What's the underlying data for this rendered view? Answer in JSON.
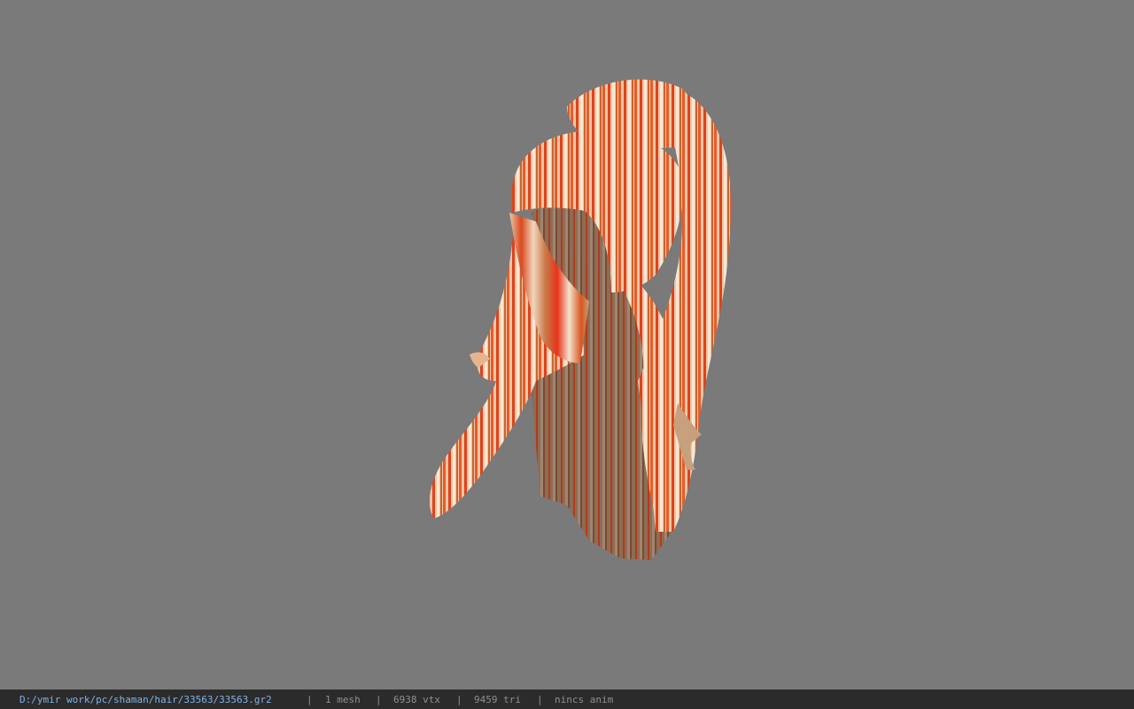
{
  "viewer": {
    "background_color": "#7a7a7a",
    "model_icon": "hair-mesh"
  },
  "status": {
    "file_path": "D:/ymir work/pc/shaman/hair/33563/33563.gr2",
    "separator": "|",
    "mesh_count": "1 mesh",
    "vertex_count": "6938 vtx",
    "triangle_count": "9459 tri",
    "anim_status": "nincs anim",
    "path_color": "#7fb3e6",
    "text_color": "#8f8f8f",
    "bar_color": "#2b2b2b"
  }
}
